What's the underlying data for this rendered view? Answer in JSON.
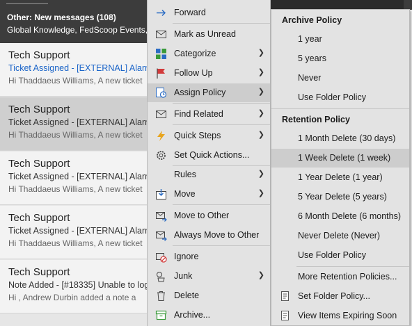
{
  "message_list": {
    "header_title": "Other: New messages (108)",
    "header_senders": "Global Knowledge, FedScoop Events, ",
    "messages": [
      {
        "sender": "Tech Support",
        "subject": "Ticket Assigned - [EXTERNAL] Alarm",
        "preview": "Hi Thaddaeus Williams,  A new ticket"
      },
      {
        "sender": "Tech Support",
        "subject": "Ticket Assigned - [EXTERNAL] Alarm",
        "preview": "Hi Thaddaeus Williams,  A new ticket"
      },
      {
        "sender": "Tech Support",
        "subject": "Ticket Assigned - [EXTERNAL] Alarm",
        "preview": "Hi Thaddaeus Williams,  A new ticket"
      },
      {
        "sender": "Tech Support",
        "subject": "Ticket Assigned - [EXTERNAL] Alarm",
        "preview": "Hi Thaddaeus Williams,  A new ticket"
      },
      {
        "sender": "Tech Support",
        "subject": "Note Added - [#18335] Unable to log",
        "preview": "Hi ,  Andrew Durbin added a note a"
      }
    ]
  },
  "context_menu": {
    "items": [
      {
        "label": "Forward",
        "icon": "forward-arrow-icon"
      },
      {
        "label": "Mark as Unread",
        "icon": "envelope-icon"
      },
      {
        "label": "Categorize",
        "icon": "categorize-grid-icon"
      },
      {
        "label": "Follow Up",
        "icon": "flag-icon"
      },
      {
        "label": "Assign Policy",
        "icon": "policy-icon"
      },
      {
        "label": "Find Related",
        "icon": "envelope-search-icon"
      },
      {
        "label": "Quick Steps",
        "icon": "lightning-icon"
      },
      {
        "label": "Set Quick Actions...",
        "icon": "gear-icon"
      },
      {
        "label": "Rules",
        "icon": "rules-icon"
      },
      {
        "label": "Move",
        "icon": "move-icon"
      },
      {
        "label": "Move to Other",
        "icon": "envelope-move-icon"
      },
      {
        "label": "Always Move to Other",
        "icon": "envelope-move-always-icon"
      },
      {
        "label": "Ignore",
        "icon": "ignore-icon"
      },
      {
        "label": "Junk",
        "icon": "junk-icon"
      },
      {
        "label": "Delete",
        "icon": "trash-icon"
      },
      {
        "label": "Archive...",
        "icon": "archive-box-icon"
      }
    ]
  },
  "submenu": {
    "archive_header": "Archive Policy",
    "archive_items": [
      "1 year",
      "5 years",
      "Never",
      "Use Folder Policy"
    ],
    "retention_header": "Retention Policy",
    "retention_items": [
      "1 Month Delete (30 days)",
      "1 Week Delete (1 week)",
      "1 Year Delete (1 year)",
      "5 Year Delete (5 years)",
      "6 Month Delete (6 months)",
      "Never Delete (Never)",
      "Use Folder Policy"
    ],
    "more_label": "More Retention Policies...",
    "set_folder_label": "Set Folder Policy...",
    "view_expiring_label": "View Items Expiring Soon"
  },
  "colors": {
    "accent_blue": "#1a64c8",
    "menu_bg": "#e3e3e3",
    "highlight": "#cdcdcd"
  }
}
